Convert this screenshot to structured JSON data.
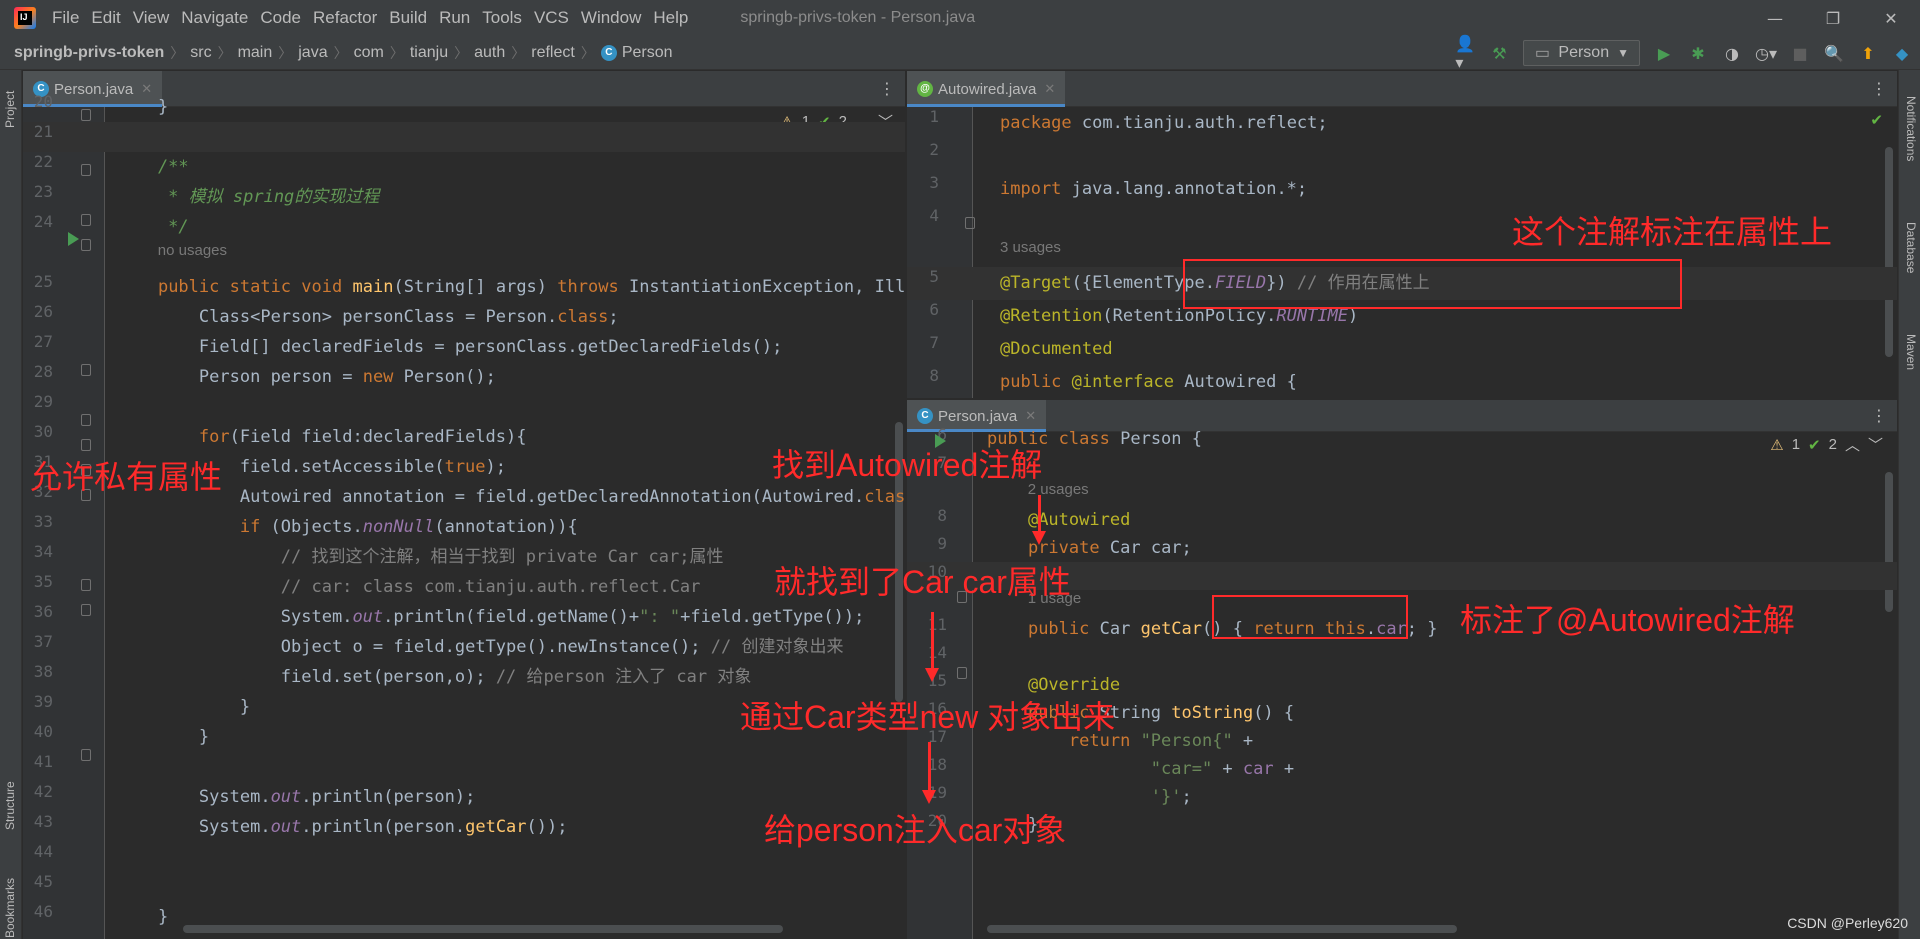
{
  "window": {
    "title": "springb-privs-token - Person.java",
    "menu": [
      "File",
      "Edit",
      "View",
      "Navigate",
      "Code",
      "Refactor",
      "Build",
      "Run",
      "Tools",
      "VCS",
      "Window",
      "Help"
    ],
    "controls": {
      "minimize": "—",
      "restore": "❐",
      "close": "✕"
    }
  },
  "breadcrumb": [
    "springb-privs-token",
    "src",
    "main",
    "java",
    "com",
    "tianju",
    "auth",
    "reflect",
    "Person"
  ],
  "toolbar": {
    "run_config": "Person",
    "icons": [
      "user-icon",
      "hammer-icon",
      "run-icon",
      "debug-icon",
      "coverage-icon",
      "profile-icon",
      "stop-icon",
      "search-icon",
      "update-icon",
      "plugin-icon"
    ]
  },
  "left_strip": {
    "project": "Project",
    "structure": "Structure",
    "bookmarks": "Bookmarks"
  },
  "right_strip": {
    "notifications": "Notifications",
    "database": "Database",
    "maven": "Maven"
  },
  "left_editor": {
    "tab": "Person.java",
    "inspections": {
      "warnings": "1",
      "weak_warnings": "2"
    },
    "lines": [
      {
        "n": "20",
        "t": "    }"
      },
      {
        "n": "21",
        "t": ""
      },
      {
        "n": "22",
        "t": "    /**"
      },
      {
        "n": "23",
        "t": "     * 模拟 spring的实现过程"
      },
      {
        "n": "24",
        "t": "     */"
      },
      {
        "n": "",
        "t": "    no usages"
      },
      {
        "n": "25",
        "t": "    public static void main(String[] args) throws InstantiationException, IllegalAccessExce"
      },
      {
        "n": "26",
        "t": "        Class<Person> personClass = Person.class;"
      },
      {
        "n": "27",
        "t": "        Field[] declaredFields = personClass.getDeclaredFields();"
      },
      {
        "n": "28",
        "t": "        Person person = new Person();"
      },
      {
        "n": "29",
        "t": ""
      },
      {
        "n": "30",
        "t": "        for(Field field:declaredFields){"
      },
      {
        "n": "31",
        "t": "            field.setAccessible(true);"
      },
      {
        "n": "32",
        "t": "            Autowired annotation = field.getDeclaredAnnotation(Autowired.class);"
      },
      {
        "n": "33",
        "t": "            if (Objects.nonNull(annotation)){"
      },
      {
        "n": "34",
        "t": "                // 找到这个注解，相当于找到 private Car car;属性"
      },
      {
        "n": "35",
        "t": "                // car: class com.tianju.auth.reflect.Car"
      },
      {
        "n": "36",
        "t": "                System.out.println(field.getName()+\": \"+field.getType());"
      },
      {
        "n": "37",
        "t": "                Object o = field.getType().newInstance(); // 创建对象出来"
      },
      {
        "n": "38",
        "t": "                field.set(person,o); // 给person 注入了 car 对象"
      },
      {
        "n": "39",
        "t": "            }"
      },
      {
        "n": "40",
        "t": "        }"
      },
      {
        "n": "41",
        "t": ""
      },
      {
        "n": "42",
        "t": "        System.out.println(person);"
      },
      {
        "n": "43",
        "t": "        System.out.println(person.getCar());"
      },
      {
        "n": "44",
        "t": ""
      },
      {
        "n": "45",
        "t": ""
      },
      {
        "n": "46",
        "t": "    }"
      }
    ]
  },
  "right_top_editor": {
    "tab": "Autowired.java",
    "lines": [
      {
        "n": "1",
        "t": "package com.tianju.auth.reflect;"
      },
      {
        "n": "2",
        "t": ""
      },
      {
        "n": "3",
        "t": "import java.lang.annotation.*;"
      },
      {
        "n": "4",
        "t": ""
      },
      {
        "n": "",
        "t": "3 usages"
      },
      {
        "n": "5",
        "t": "@Target({ElementType.FIELD}) // 作用在属性上"
      },
      {
        "n": "6",
        "t": "@Retention(RetentionPolicy.RUNTIME)"
      },
      {
        "n": "7",
        "t": "@Documented"
      },
      {
        "n": "8",
        "t": "public @interface Autowired {"
      },
      {
        "n": "9",
        "t": "}"
      },
      {
        "n": "10",
        "t": ""
      }
    ]
  },
  "right_bottom_editor": {
    "tab": "Person.java",
    "inspections": {
      "warnings": "1",
      "weak_warnings": "2"
    },
    "lines": [
      {
        "n": "6",
        "t": "public class Person {"
      },
      {
        "n": "7",
        "t": ""
      },
      {
        "n": "",
        "t": "    2 usages"
      },
      {
        "n": "8",
        "t": "    @Autowired"
      },
      {
        "n": "9",
        "t": "    private Car car;"
      },
      {
        "n": "10",
        "t": ""
      },
      {
        "n": "",
        "t": "    1 usage"
      },
      {
        "n": "11",
        "t": "    public Car getCar() { return this.car; }"
      },
      {
        "n": "14",
        "t": ""
      },
      {
        "n": "15",
        "t": "    @Override"
      },
      {
        "n": "16",
        "t": "    public String toString() {"
      },
      {
        "n": "17",
        "t": "        return \"Person{\" +"
      },
      {
        "n": "18",
        "t": "                \"car=\" + car +"
      },
      {
        "n": "19",
        "t": "                '}';"
      },
      {
        "n": "20",
        "t": "    }"
      }
    ]
  },
  "annotations": {
    "allow_private": "允许私有属性",
    "find_autowired": "找到Autowired注解",
    "found_car": "就找到了Car car属性",
    "new_object": "通过Car类型new 对象出来",
    "inject": "给person注入car对象",
    "on_field": "这个注解标注在属性上",
    "marked": "标注了@Autowired注解"
  },
  "watermark": "CSDN @Perley620",
  "colors": {
    "annotation_red": "#ff2a2a",
    "editor_bg": "#2b2b2b",
    "chrome_bg": "#3c3f41",
    "tab_underline": "#4a88c7"
  }
}
